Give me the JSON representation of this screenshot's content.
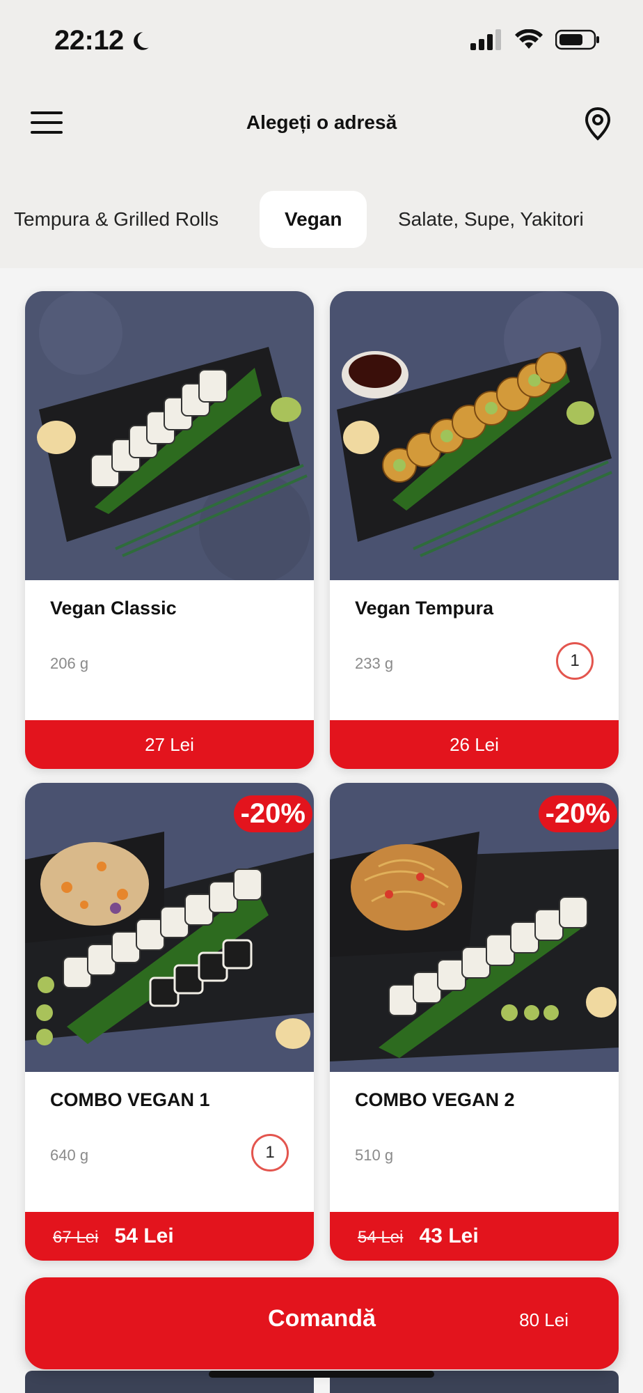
{
  "status_bar": {
    "time": "22:12"
  },
  "header": {
    "address_placeholder": "Alegeți o adresă"
  },
  "tabs": [
    {
      "label": "Tempura & Grilled Rolls",
      "active": false
    },
    {
      "label": "Vegan",
      "active": true
    },
    {
      "label": "Salate, Supe, Yakitori",
      "active": false
    }
  ],
  "products": [
    {
      "name": "Vegan Classic",
      "weight": "206 g",
      "price": "27 Lei",
      "quantity": null,
      "discount": null,
      "old_price": null
    },
    {
      "name": "Vegan Tempura",
      "weight": "233 g",
      "price": "26 Lei",
      "quantity": "1",
      "discount": null,
      "old_price": null
    },
    {
      "name": "COMBO VEGAN 1",
      "weight": "640 g",
      "price": "54 Lei",
      "quantity": "1",
      "discount": "-20%",
      "old_price": "67 Lei"
    },
    {
      "name": "COMBO VEGAN 2",
      "weight": "510 g",
      "price": "43 Lei",
      "quantity": null,
      "discount": "-20%",
      "old_price": "54 Lei"
    }
  ],
  "order_button": {
    "label": "Comandă",
    "total": "80 Lei"
  },
  "colors": {
    "accent": "#e3141d",
    "header_bg": "#efeeec",
    "badge_border": "#e3554e"
  },
  "icons": [
    "moon-icon",
    "signal-icon",
    "wifi-icon",
    "battery-icon",
    "menu-icon",
    "location-pin-icon"
  ]
}
